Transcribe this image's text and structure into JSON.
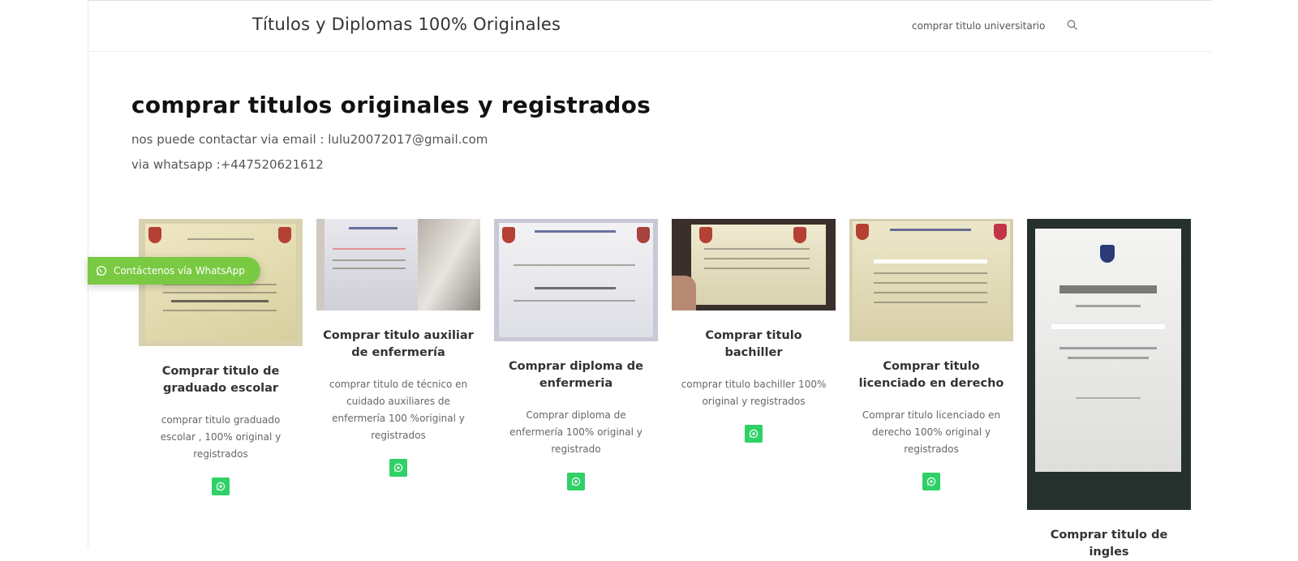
{
  "header": {
    "site_title": "Títulos y Diplomas 100% Originales",
    "nav_link": "comprar titulo universitario",
    "search_icon": "search-icon"
  },
  "main": {
    "title": "comprar titulos originales y registrados",
    "contact_email": "nos puede contactar via email : lulu20072017@gmail.com",
    "contact_whatsapp": "via whatsapp :+447520621612"
  },
  "floating_whatsapp": {
    "label": "Contáctenos vía WhatsApp",
    "icon": "whatsapp-icon"
  },
  "colors": {
    "whatsapp_float": "#7ac943",
    "whatsapp_button": "#2fd166"
  },
  "products": [
    {
      "title": "Comprar titulo de graduado escolar",
      "description": "comprar titulo graduado escolar , 100% original y registrados"
    },
    {
      "title": "Comprar titulo auxiliar de enfermería",
      "description": "comprar titulo de técnico en cuidado auxiliares de enfermería 100 %original y registrados"
    },
    {
      "title": "Comprar diploma de enfermeria",
      "description": "Comprar diploma de enfermería 100% original y registrado"
    },
    {
      "title": "Comprar titulo bachiller",
      "description": "comprar titulo bachiller 100% original y registrados"
    },
    {
      "title": "Comprar titulo licenciado en derecho",
      "description": "Comprar titulo licenciado en derecho 100% original y registrados"
    },
    {
      "title": "Comprar titulo de ingles",
      "description": ""
    }
  ]
}
